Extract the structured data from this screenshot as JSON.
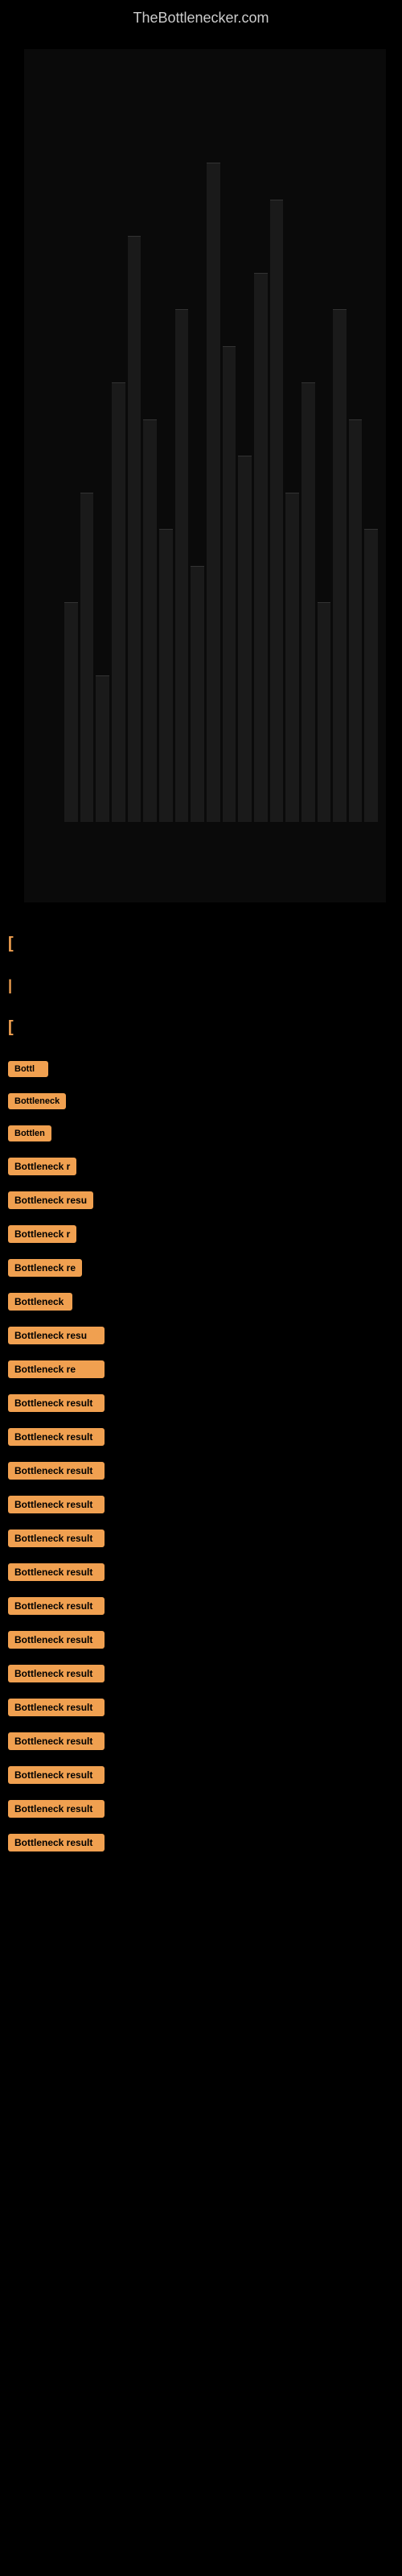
{
  "site": {
    "title": "TheBottlenecker.com"
  },
  "chart": {
    "bars": [
      30,
      45,
      20,
      60,
      80,
      55,
      40,
      70,
      35,
      90,
      65,
      50,
      75,
      85,
      45,
      60,
      30,
      70,
      55,
      40
    ]
  },
  "markers": [
    {
      "type": "bracket",
      "symbol": "["
    },
    {
      "type": "pipe",
      "symbol": "|"
    },
    {
      "type": "bracket",
      "symbol": "["
    }
  ],
  "results": [
    {
      "label": "Bottl",
      "size": "xs"
    },
    {
      "label": "Bottleneck",
      "size": "sm"
    },
    {
      "label": "Bottlen",
      "size": "xs"
    },
    {
      "label": "Bottleneck r",
      "size": "sm"
    },
    {
      "label": "Bottleneck resu",
      "size": "md"
    },
    {
      "label": "Bottleneck r",
      "size": "sm"
    },
    {
      "label": "Bottleneck re",
      "size": "md"
    },
    {
      "label": "Bottleneck",
      "size": "sm"
    },
    {
      "label": "Bottleneck resu",
      "size": "md"
    },
    {
      "label": "Bottleneck re",
      "size": "md"
    },
    {
      "label": "Bottleneck result",
      "size": "lg"
    },
    {
      "label": "Bottleneck result",
      "size": "lg"
    },
    {
      "label": "Bottleneck result",
      "size": "lg"
    },
    {
      "label": "Bottleneck result",
      "size": "lg"
    },
    {
      "label": "Bottleneck result",
      "size": "lg"
    },
    {
      "label": "Bottleneck result",
      "size": "lg"
    },
    {
      "label": "Bottleneck result",
      "size": "lg"
    },
    {
      "label": "Bottleneck result",
      "size": "lg"
    },
    {
      "label": "Bottleneck result",
      "size": "lg"
    },
    {
      "label": "Bottleneck result",
      "size": "lg"
    },
    {
      "label": "Bottleneck result",
      "size": "lg"
    },
    {
      "label": "Bottleneck result",
      "size": "lg"
    },
    {
      "label": "Bottleneck result",
      "size": "lg"
    },
    {
      "label": "Bottleneck result",
      "size": "lg"
    }
  ]
}
